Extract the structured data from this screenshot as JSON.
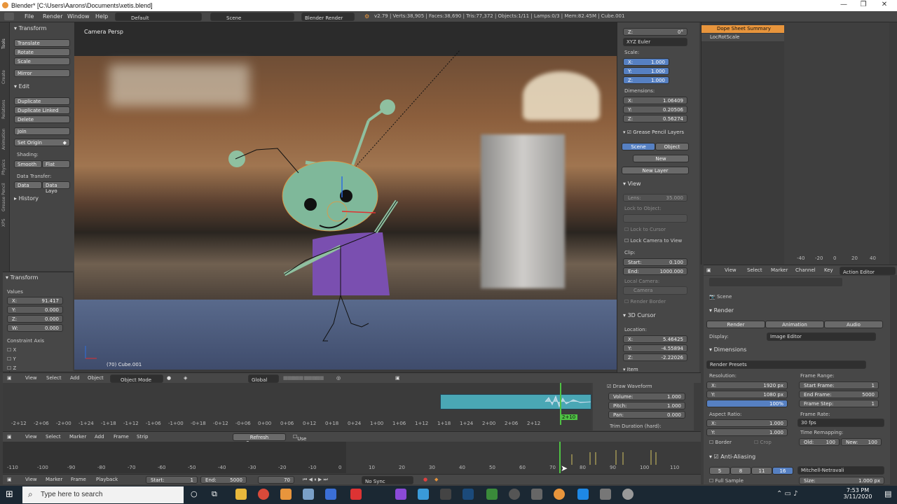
{
  "window": {
    "title": "Blender* [C:\\Users\\Aarons\\Documents\\xetis.blend]",
    "min": "—",
    "max": "❐",
    "close": "✕"
  },
  "menubar": {
    "items": [
      "File",
      "Render",
      "Window",
      "Help"
    ],
    "layout": "Default",
    "scene": "Scene",
    "engine": "Blender Render",
    "stats": "v2.79 | Verts:38,905 | Faces:38,690 | Tris:77,372 | Objects:1/11 | Lamps:0/3 | Mem:82.45M | Cube.001"
  },
  "tool_tabs": [
    "Tools",
    "Create",
    "Relations",
    "Animation",
    "Physics",
    "Grease Pencil",
    "XPS"
  ],
  "tool_shelf": {
    "transform_header": "Transform",
    "translate": "Translate",
    "rotate": "Rotate",
    "scale": "Scale",
    "mirror": "Mirror",
    "edit_header": "Edit",
    "duplicate": "Duplicate",
    "duplicate_linked": "Duplicate Linked",
    "delete": "Delete",
    "join": "Join",
    "set_origin": "Set Origin",
    "shading_label": "Shading:",
    "smooth": "Smooth",
    "flat": "Flat",
    "data_transfer_label": "Data Transfer:",
    "data": "Data",
    "data_layout": "Data Layo",
    "history_header": "History"
  },
  "operator": {
    "header": "Transform",
    "values_label": "Values",
    "x": "91.417",
    "y": "0.000",
    "z": "0.000",
    "w": "0.000",
    "constraint_label": "Constraint Axis",
    "axes": [
      "X",
      "Y",
      "Z"
    ]
  },
  "viewport": {
    "label": "Camera Persp",
    "object_label": "(70) Cube.001"
  },
  "properties": {
    "z_top": "0°",
    "rotation_mode": "XYZ Euler",
    "scale_label": "Scale:",
    "scale_x": "1.000",
    "scale_y": "1.000",
    "scale_z": "1.000",
    "dimensions_label": "Dimensions:",
    "dim_x": "1.06409",
    "dim_y": "0.20506",
    "dim_z": "0.56274",
    "grease_header": "Grease Pencil Layers",
    "scene_tab": "Scene",
    "object_tab": "Object",
    "new": "New",
    "new_layer": "New Layer",
    "view_header": "View",
    "lens_label": "Lens:",
    "lens": "35.000",
    "lock_object": "Lock to Object:",
    "lock_cursor": "Lock to Cursor",
    "lock_camera": "Lock Camera to View",
    "clip_label": "Clip:",
    "clip_start": "0.100",
    "clip_end": "1000.000",
    "local_camera": "Local Camera:",
    "camera": "Camera",
    "render_border": "Render Border",
    "cursor_header": "3D Cursor",
    "location_label": "Location:",
    "loc_x": "5.46425",
    "loc_y": "-4.55894",
    "loc_z": "-2.22026",
    "item_header": "Item"
  },
  "view3d_header": {
    "view": "View",
    "select": "Select",
    "add": "Add",
    "object": "Object",
    "mode": "Object Mode",
    "orientation": "Global"
  },
  "sequencer": {
    "strip_label": "2+10",
    "draw_waveform": "Draw Waveform",
    "volume_label": "Volume:",
    "volume": "1.000",
    "pitch_label": "Pitch:",
    "pitch": "1.000",
    "pan_label": "Pan:",
    "pan": "0.000",
    "trim": "Trim Duration (hard):",
    "ticks": [
      "-2+12",
      "-2+06",
      "-2+00",
      "-1+24",
      "-1+18",
      "-1+12",
      "-1+06",
      "-1+00",
      "-0+18",
      "-0+12",
      "-0+06",
      "0+00",
      "0+06",
      "0+12",
      "0+18",
      "0+24",
      "1+00",
      "1+06",
      "1+12",
      "1+18",
      "1+24",
      "2+00",
      "2+06",
      "2+12"
    ]
  },
  "seq_header": {
    "view": "View",
    "select": "Select",
    "marker": "Marker",
    "add": "Add",
    "frame": "Frame",
    "strip": "Strip",
    "refresh": "Refresh Sequencer",
    "backdrop": "Use Backdrop"
  },
  "timeline": {
    "ticks": [
      "-110",
      "-100",
      "-90",
      "-80",
      "-70",
      "-60",
      "-50",
      "-40",
      "-30",
      "-20",
      "-10",
      "0",
      "10",
      "20",
      "30",
      "40",
      "50",
      "60",
      "70",
      "80",
      "90",
      "100",
      "110"
    ]
  },
  "timeline_header": {
    "view": "View",
    "marker": "Marker",
    "frame": "Frame",
    "playback": "Playback",
    "start_label": "Start:",
    "start": "1",
    "end_label": "End:",
    "end": "5000",
    "current": "70",
    "sync": "No Sync"
  },
  "dopesheet": {
    "summary": "Dope Sheet Summary",
    "channel": "LocRotScale",
    "ticks": [
      "-40",
      "-20",
      "0",
      "20",
      "40"
    ],
    "view": "View",
    "select": "Select",
    "marker": "Marker",
    "channel_menu": "Channel",
    "key": "Key",
    "mode": "Action Editor"
  },
  "render_props": {
    "scene": "Scene",
    "render_header": "Render",
    "render_btn": "Render",
    "animation_btn": "Animation",
    "audio_btn": "Audio",
    "display_label": "Display:",
    "display": "Image Editor",
    "dimensions_header": "Dimensions",
    "presets": "Render Presets",
    "resolution_label": "Resolution:",
    "res_x": "1920 px",
    "res_y": "1080 px",
    "res_pct": "100%",
    "frame_range_label": "Frame Range:",
    "start_frame_label": "Start Frame:",
    "start_frame": "1",
    "end_frame_label": "End Frame:",
    "end_frame": "5000",
    "frame_step_label": "Frame Step:",
    "frame_step": "1",
    "aspect_label": "Aspect Ratio:",
    "aspect_x": "1.000",
    "aspect_y": "1.000",
    "frame_rate_label": "Frame Rate:",
    "fps": "30 fps",
    "border": "Border",
    "crop": "Crop",
    "remap_label": "Time Remapping:",
    "old_label": "Old:",
    "old": "100",
    "new_label": "New:",
    "new": "100",
    "aa_header": "Anti-Aliasing",
    "aa_samples": [
      "5",
      "8",
      "11",
      "16"
    ],
    "filter": "Mitchell-Netravali",
    "full_sample": "Full Sample",
    "size_label": "Size:",
    "size": "1.000 px"
  },
  "taskbar": {
    "search_placeholder": "Type here to search",
    "time": "7:53 PM",
    "date": "3/11/2020"
  },
  "colors": {
    "accent": "#5680c2",
    "orange": "#e8953c",
    "strip": "#4aa7b5",
    "taskbar": "#1b2833"
  }
}
